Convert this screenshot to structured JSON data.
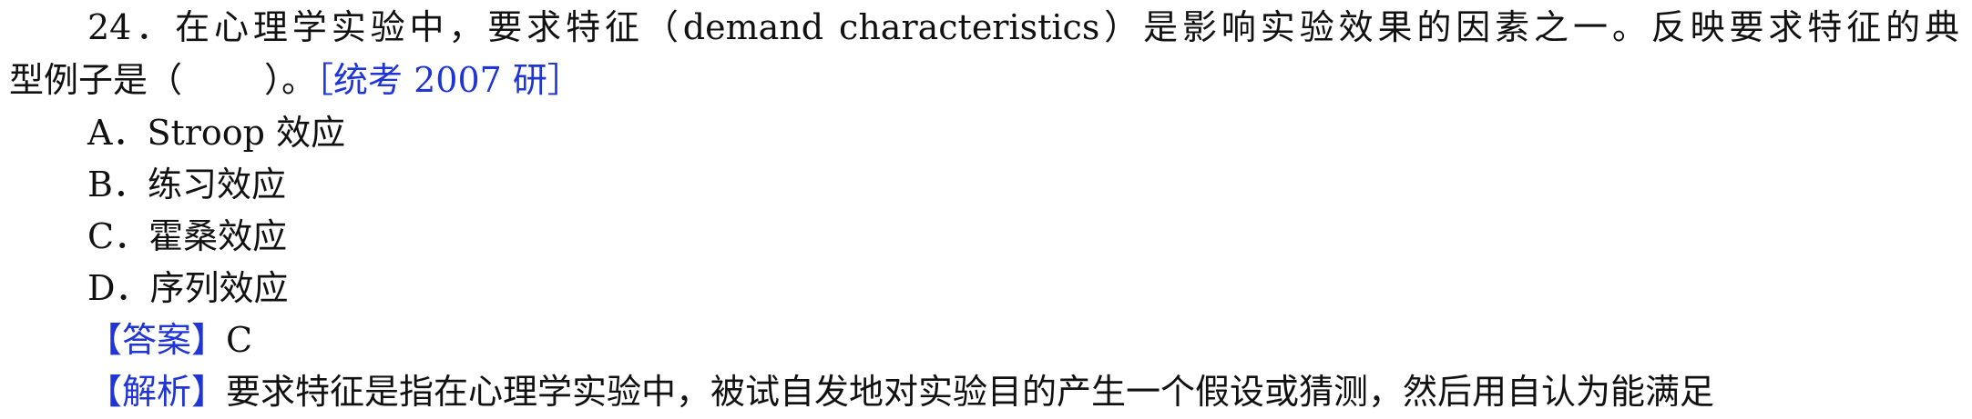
{
  "question": {
    "line1": "24．在心理学实验中，要求特征（demand characteristics）是影响实验效果的因素之一。反映要求特征的典",
    "line2_prefix": "型例子是（",
    "line2_suffix": "）。",
    "source": "［统考 2007 研］"
  },
  "options": [
    {
      "label": "A．",
      "text": "Stroop 效应"
    },
    {
      "label": "B．",
      "text": "练习效应"
    },
    {
      "label": "C．",
      "text": "霍桑效应"
    },
    {
      "label": "D．",
      "text": "序列效应"
    }
  ],
  "answer": {
    "tag": "【答案】",
    "value": "C"
  },
  "analysis": {
    "tag": "【解析】",
    "text": "要求特征是指在心理学实验中，被试自发地对实验目的产生一个假设或猜测，然后用自认为能满足"
  },
  "colors": {
    "text": "#111111",
    "accent": "#1f35d6"
  }
}
